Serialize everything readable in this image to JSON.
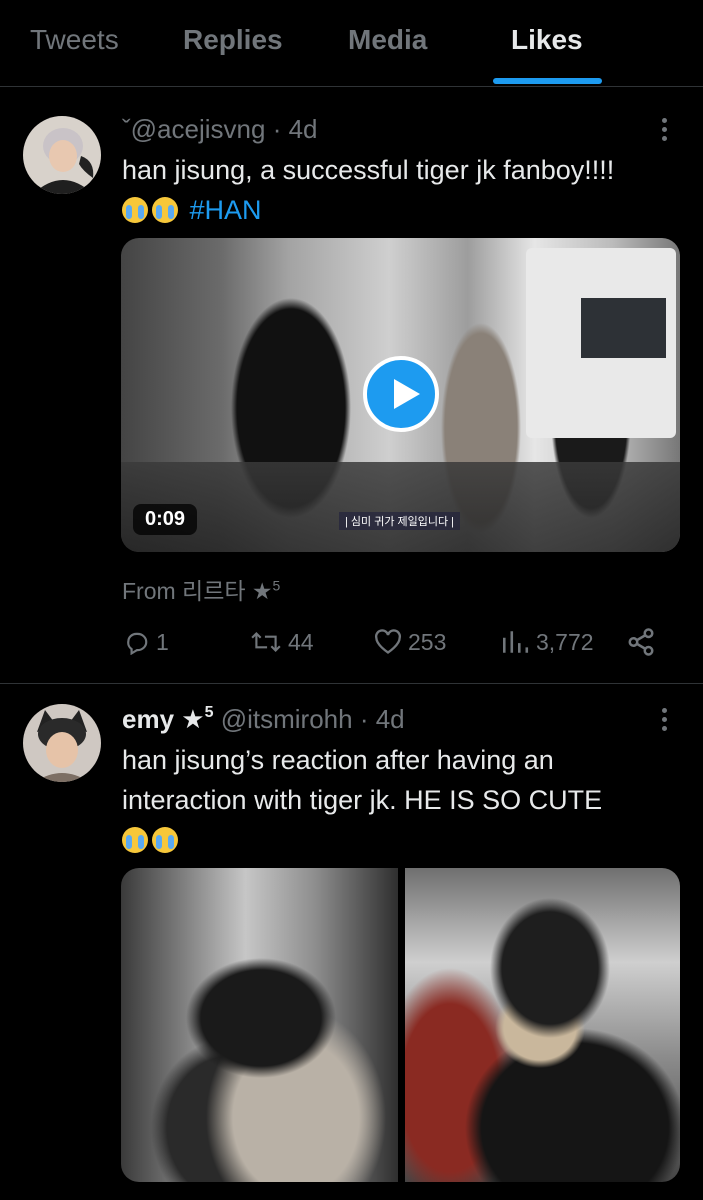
{
  "tabs": [
    {
      "label": "Tweets"
    },
    {
      "label": "Replies"
    },
    {
      "label": "Media"
    },
    {
      "label": "Likes"
    }
  ],
  "active_tab": "Likes",
  "accent_color": "#1d9bf0",
  "tweets": [
    {
      "name": "",
      "handle": "ˇ@acejisvng",
      "time": "· 4d",
      "text": "han jisung, a successful tiger jk fanboy!!!!",
      "emojis": "😭😭",
      "hashtag": "#HAN",
      "video": {
        "duration": "0:09",
        "subtitle": "| 심미 귀가 제일입니다 |"
      },
      "from": "From 리르타 ★",
      "from_sup": "5",
      "stats": {
        "replies": "1",
        "retweets": "44",
        "likes": "253",
        "views": "3,772"
      }
    },
    {
      "name": "emy ★",
      "name_sup": "5",
      "handle": "@itsmirohh",
      "time": "· 4d",
      "text": "han jisung’s reaction after having an interaction with tiger jk. HE IS SO CUTE",
      "emojis": "😭😭"
    }
  ]
}
